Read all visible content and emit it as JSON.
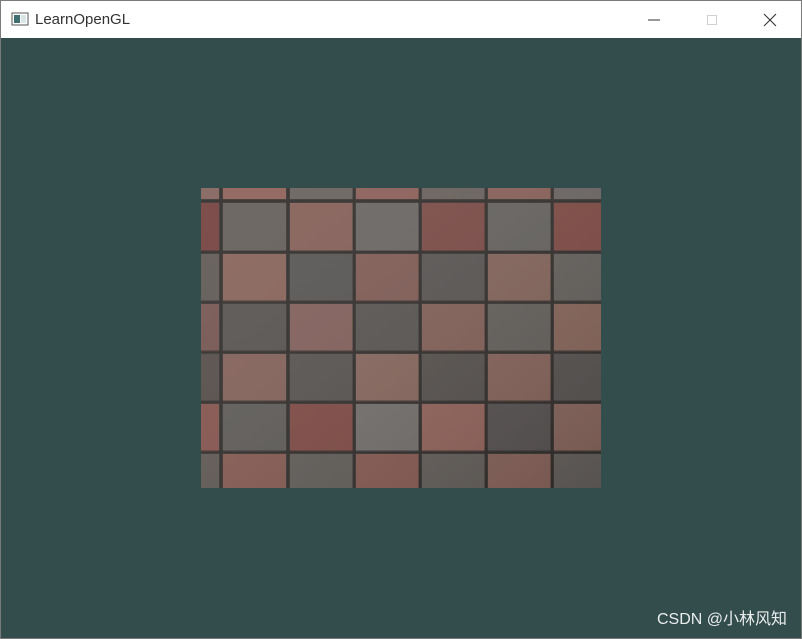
{
  "window": {
    "title": "LearnOpenGL",
    "app_icon": "app-window-icon"
  },
  "title_controls": {
    "minimize": "minimize-icon",
    "maximize": "maximize-icon",
    "close": "close-icon"
  },
  "canvas": {
    "clear_color": "#334d4d",
    "texture": {
      "name": "checkerboard-brick-texture",
      "base_colors": [
        "#7f5f5a",
        "#6e6864",
        "#8a6259",
        "#7b4a45",
        "#5d5a58"
      ]
    }
  },
  "watermark": {
    "text": "CSDN @小林风知"
  }
}
